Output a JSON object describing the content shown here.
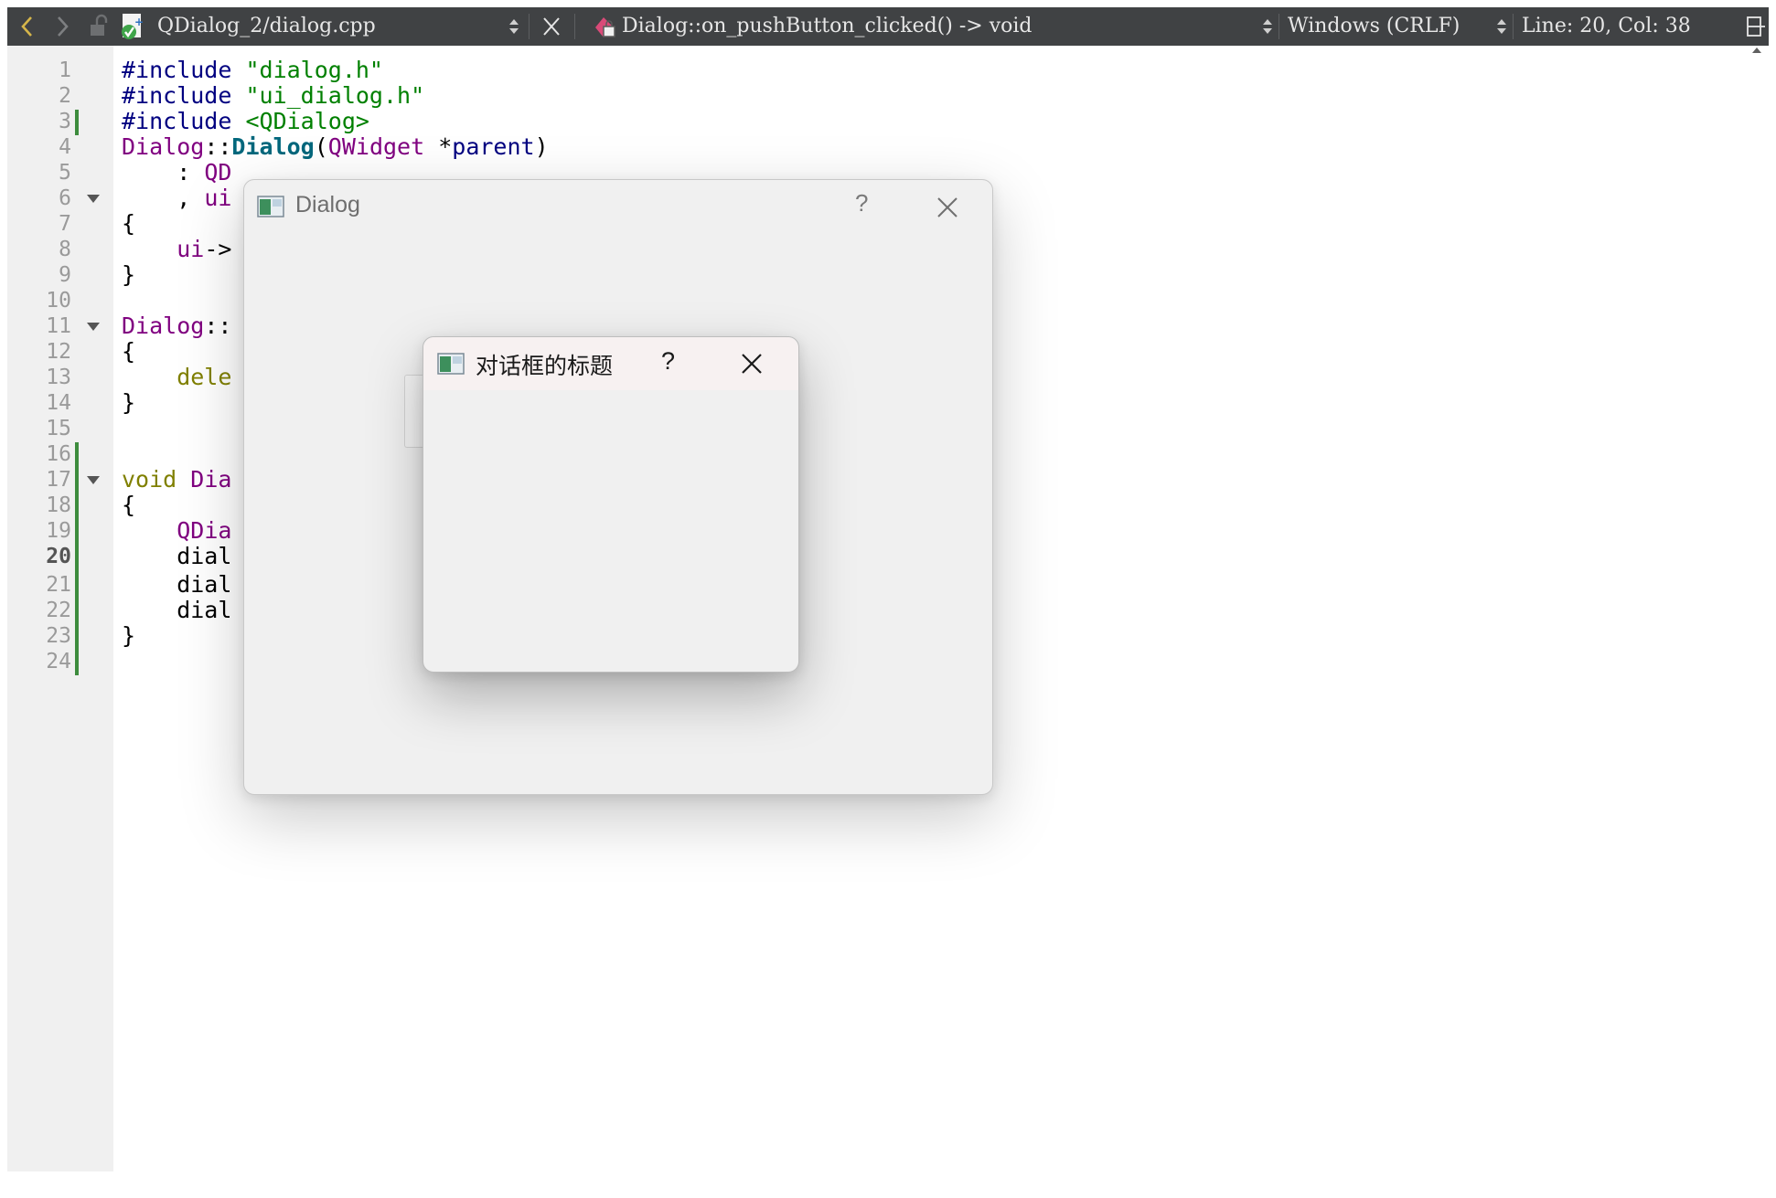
{
  "toolbar": {
    "file_name": "QDialog_2/dialog.cpp",
    "function_name": "Dialog::on_pushButton_clicked() -> void",
    "line_ending": "Windows (CRLF)",
    "cursor_position": "Line: 20, Col: 38",
    "icons": [
      "back-arrow-icon",
      "forward-arrow-icon",
      "lock-icon",
      "file-cpp-icon",
      "dropdown-arrows-icon",
      "close-icon",
      "function-icon",
      "split-icon"
    ]
  },
  "editor": {
    "current_line": 20,
    "line_numbers": [
      "1",
      "2",
      "3",
      "4",
      "5",
      "6",
      "7",
      "8",
      "9",
      "10",
      "11",
      "12",
      "13",
      "14",
      "15",
      "16",
      "17",
      "18",
      "19",
      "20",
      "21",
      "22",
      "23",
      "24"
    ],
    "lines": [
      {
        "n": 1,
        "tokens": [
          {
            "t": "#include ",
            "c": "pp"
          },
          {
            "t": "\"dialog.h\"",
            "c": "str"
          }
        ]
      },
      {
        "n": 2,
        "tokens": [
          {
            "t": "#include ",
            "c": "pp"
          },
          {
            "t": "\"ui_dialog.h\"",
            "c": "str"
          }
        ]
      },
      {
        "n": 3,
        "tokens": [
          {
            "t": "#include ",
            "c": "pp"
          },
          {
            "t": "<QDialog>",
            "c": "str"
          }
        ]
      },
      {
        "n": 4,
        "tokens": [
          {
            "t": "Dialog",
            "c": "cls"
          },
          {
            "t": "::",
            "c": "sym"
          },
          {
            "t": "Dialog",
            "c": "fn"
          },
          {
            "t": "(",
            "c": "sym"
          },
          {
            "t": "QWidget",
            "c": "cls"
          },
          {
            "t": " *",
            "c": "sym"
          },
          {
            "t": "parent",
            "c": "pp"
          },
          {
            "t": ")",
            "c": "sym"
          }
        ]
      },
      {
        "n": 5,
        "tokens": [
          {
            "t": "    : ",
            "c": "sym"
          },
          {
            "t": "QD",
            "c": "cls"
          }
        ]
      },
      {
        "n": 6,
        "tokens": [
          {
            "t": "    , ",
            "c": "sym"
          },
          {
            "t": "ui",
            "c": "cls"
          }
        ]
      },
      {
        "n": 7,
        "tokens": [
          {
            "t": "{",
            "c": "sym"
          }
        ]
      },
      {
        "n": 8,
        "tokens": [
          {
            "t": "    ",
            "c": "sym"
          },
          {
            "t": "ui",
            "c": "cls"
          },
          {
            "t": "->",
            "c": "sym"
          }
        ]
      },
      {
        "n": 9,
        "tokens": [
          {
            "t": "}",
            "c": "sym"
          }
        ]
      },
      {
        "n": 10,
        "tokens": []
      },
      {
        "n": 11,
        "tokens": [
          {
            "t": "Dialog",
            "c": "cls"
          },
          {
            "t": "::",
            "c": "sym"
          }
        ]
      },
      {
        "n": 12,
        "tokens": [
          {
            "t": "{",
            "c": "sym"
          }
        ]
      },
      {
        "n": 13,
        "tokens": [
          {
            "t": "    dele",
            "c": "kw"
          }
        ]
      },
      {
        "n": 14,
        "tokens": [
          {
            "t": "}",
            "c": "sym"
          }
        ]
      },
      {
        "n": 15,
        "tokens": []
      },
      {
        "n": 16,
        "tokens": []
      },
      {
        "n": 17,
        "tokens": [
          {
            "t": "void ",
            "c": "kw"
          },
          {
            "t": "Dia",
            "c": "cls"
          }
        ]
      },
      {
        "n": 18,
        "tokens": [
          {
            "t": "{",
            "c": "sym"
          }
        ]
      },
      {
        "n": 19,
        "tokens": [
          {
            "t": "    ",
            "c": "sym"
          },
          {
            "t": "QDia",
            "c": "cls"
          }
        ]
      },
      {
        "n": 20,
        "tokens": [
          {
            "t": "    dial",
            "c": "sym"
          }
        ]
      },
      {
        "n": 21,
        "tokens": [
          {
            "t": "    dial",
            "c": "sym"
          }
        ]
      },
      {
        "n": 22,
        "tokens": [
          {
            "t": "    dial",
            "c": "sym"
          }
        ]
      },
      {
        "n": 23,
        "tokens": [
          {
            "t": "}",
            "c": "sym"
          }
        ]
      },
      {
        "n": 24,
        "tokens": []
      }
    ]
  },
  "dialog_outer": {
    "title": "Dialog",
    "help_label": "?"
  },
  "dialog_inner": {
    "title": "对话框的标题",
    "help_label": "?"
  },
  "colors": {
    "toolbar_bg": "#404244",
    "gutter_bg": "#f0f0f0",
    "change_bar": "#3d8c3d",
    "preprocessor": "#000080",
    "string": "#008000",
    "class": "#800080",
    "function": "#00677c",
    "keyword": "#808000"
  }
}
